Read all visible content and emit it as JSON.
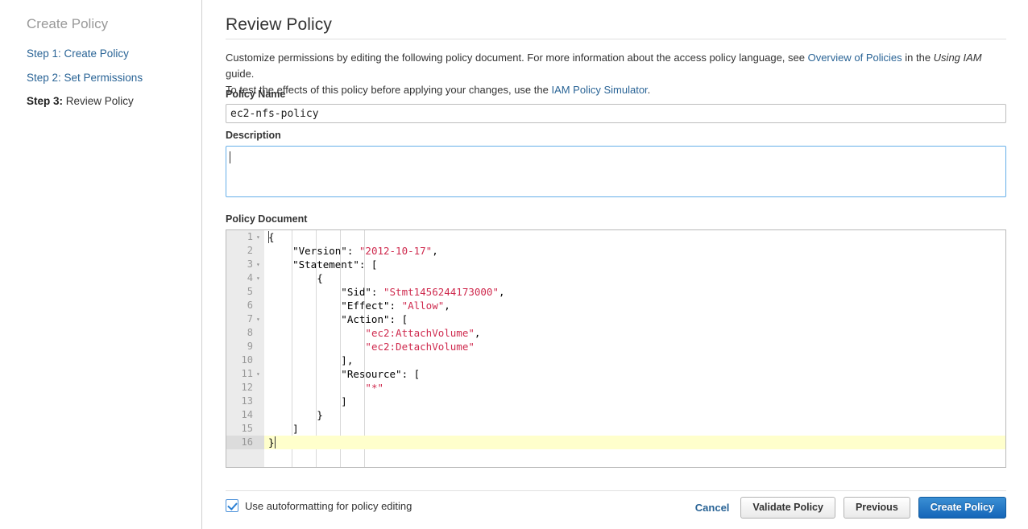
{
  "sidebar": {
    "title": "Create Policy",
    "steps": [
      {
        "num": "Step 1:",
        "label": " Create Policy",
        "current": false
      },
      {
        "num": "Step 2:",
        "label": " Set Permissions",
        "current": false
      },
      {
        "num": "Step 3:",
        "label": " Review Policy",
        "current": true
      }
    ]
  },
  "main": {
    "page_title": "Review Policy",
    "intro": {
      "part1": "Customize permissions by editing the following policy document. For more information about the access policy language, see ",
      "link1": "Overview of Policies",
      "part2": " in the ",
      "italic1": "Using IAM",
      "part3": " guide.",
      "part4": "To test the effects of this policy before applying your changes, use the ",
      "link2": "IAM Policy Simulator",
      "part5": "."
    },
    "policy_name": {
      "label": "Policy Name",
      "value": "ec2-nfs-policy",
      "placeholder": ""
    },
    "description": {
      "label": "Description",
      "value": "",
      "placeholder": ""
    },
    "policy_document": {
      "label": "Policy Document",
      "active_line": 16,
      "lines": [
        {
          "n": 1,
          "fold": true,
          "indent": 0,
          "text": "{"
        },
        {
          "n": 2,
          "fold": false,
          "indent": 1,
          "text": "    \"Version\": \"2012-10-17\","
        },
        {
          "n": 3,
          "fold": true,
          "indent": 1,
          "text": "    \"Statement\": ["
        },
        {
          "n": 4,
          "fold": true,
          "indent": 2,
          "text": "        {"
        },
        {
          "n": 5,
          "fold": false,
          "indent": 3,
          "text": "            \"Sid\": \"Stmt1456244173000\","
        },
        {
          "n": 6,
          "fold": false,
          "indent": 3,
          "text": "            \"Effect\": \"Allow\","
        },
        {
          "n": 7,
          "fold": true,
          "indent": 3,
          "text": "            \"Action\": ["
        },
        {
          "n": 8,
          "fold": false,
          "indent": 4,
          "text": "                \"ec2:AttachVolume\","
        },
        {
          "n": 9,
          "fold": false,
          "indent": 4,
          "text": "                \"ec2:DetachVolume\""
        },
        {
          "n": 10,
          "fold": false,
          "indent": 3,
          "text": "            ],"
        },
        {
          "n": 11,
          "fold": true,
          "indent": 3,
          "text": "            \"Resource\": ["
        },
        {
          "n": 12,
          "fold": false,
          "indent": 4,
          "text": "                \"*\""
        },
        {
          "n": 13,
          "fold": false,
          "indent": 3,
          "text": "            ]"
        },
        {
          "n": 14,
          "fold": false,
          "indent": 2,
          "text": "        }"
        },
        {
          "n": 15,
          "fold": false,
          "indent": 1,
          "text": "    ]"
        },
        {
          "n": 16,
          "fold": false,
          "indent": 0,
          "text": "}"
        }
      ],
      "policy_json": {
        "Version": "2012-10-17",
        "Statement": [
          {
            "Sid": "Stmt1456244173000",
            "Effect": "Allow",
            "Action": [
              "ec2:AttachVolume",
              "ec2:DetachVolume"
            ],
            "Resource": [
              "*"
            ]
          }
        ]
      }
    }
  },
  "footer": {
    "autoformat_label": "Use autoformatting for policy editing",
    "autoformat_checked": true,
    "cancel_label": "Cancel",
    "validate_label": "Validate Policy",
    "previous_label": "Previous",
    "create_label": "Create Policy"
  },
  "colors": {
    "link": "#2a6496",
    "primary_button": "#1565b8",
    "string_token": "#cf2a4e",
    "active_line": "#ffffcc",
    "focus_border": "#66afe9",
    "gutter": "#ebebeb"
  }
}
